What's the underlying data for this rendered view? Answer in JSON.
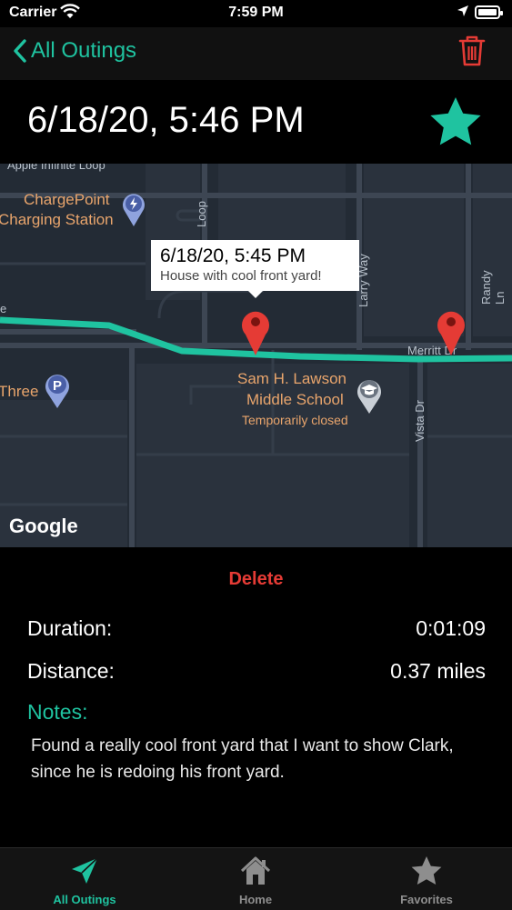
{
  "status": {
    "carrier": "Carrier",
    "time": "7:59 PM"
  },
  "nav": {
    "back_label": "All Outings"
  },
  "header": {
    "title": "6/18/20, 5:46 PM"
  },
  "map": {
    "poi": [
      {
        "name": "ChargePoint",
        "name2": "Charging Station"
      },
      {
        "name": "Three"
      },
      {
        "name": "Sam H. Lawson",
        "name2": "Middle School",
        "note": "Temporarily closed"
      }
    ],
    "roads": [
      "Apple Infinite Loop",
      "Loop",
      "Larry Way",
      "Randy Ln",
      "Merritt Dr",
      "Vista Dr",
      "e"
    ],
    "callout": {
      "title": "6/18/20, 5:45 PM",
      "subtitle": "House with cool front yard!"
    },
    "attribution": "Google"
  },
  "actions": {
    "delete_label": "Delete"
  },
  "details": {
    "duration_label": "Duration:",
    "duration_value": "0:01:09",
    "distance_label": "Distance:",
    "distance_value": "0.37 miles",
    "notes_label": "Notes:",
    "notes_text": "Found a really cool front yard that I want to show Clark, since he is redoing his front yard."
  },
  "tabs": [
    {
      "label": "All Outings",
      "icon": "paper-plane-icon"
    },
    {
      "label": "Home",
      "icon": "house-icon"
    },
    {
      "label": "Favorites",
      "icon": "star-icon"
    }
  ],
  "colors": {
    "accent": "#1fc3a0",
    "danger": "#e53b35",
    "pin": "#e53b35",
    "route": "#1fc3a0"
  }
}
